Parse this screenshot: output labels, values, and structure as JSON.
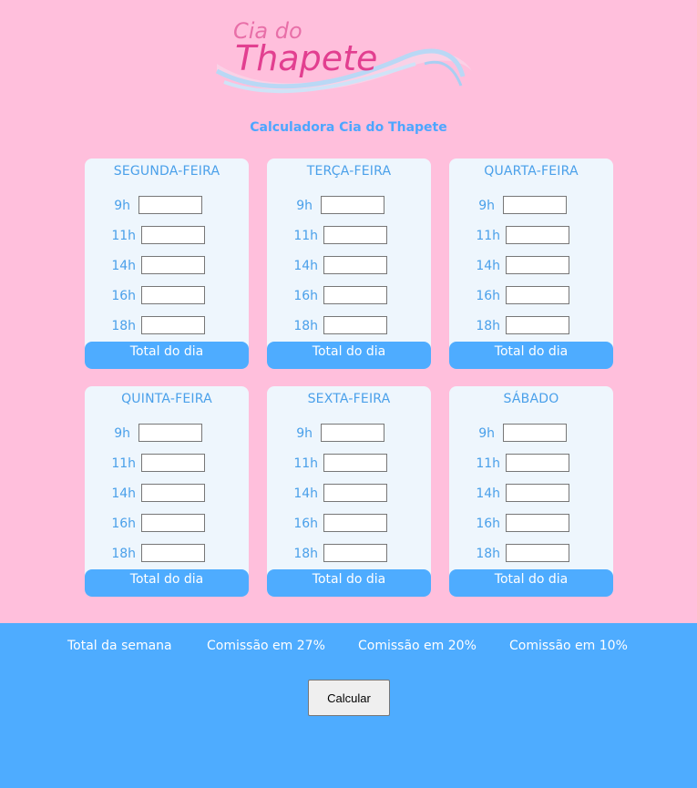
{
  "logo": {
    "line1": "Cia do",
    "line2": "Thapete"
  },
  "title": "Calculadora Cia do Thapete",
  "hours": [
    "9h",
    "11h",
    "14h",
    "16h",
    "18h"
  ],
  "days": [
    {
      "name": "SEGUNDA-FEIRA",
      "total_label": "Total do dia",
      "values": [
        "",
        "",
        "",
        "",
        ""
      ]
    },
    {
      "name": "TERÇA-FEIRA",
      "total_label": "Total do dia",
      "values": [
        "",
        "",
        "",
        "",
        ""
      ]
    },
    {
      "name": "QUARTA-FEIRA",
      "total_label": "Total do dia",
      "values": [
        "",
        "",
        "",
        "",
        ""
      ]
    },
    {
      "name": "QUINTA-FEIRA",
      "total_label": "Total do dia",
      "values": [
        "",
        "",
        "",
        "",
        ""
      ]
    },
    {
      "name": "SEXTA-FEIRA",
      "total_label": "Total do dia",
      "values": [
        "",
        "",
        "",
        "",
        ""
      ]
    },
    {
      "name": "SÁBADO",
      "total_label": "Total do dia",
      "values": [
        "",
        "",
        "",
        "",
        ""
      ]
    }
  ],
  "summary": {
    "total_week": "Total da semana",
    "commission_27": "Comissão em 27%",
    "commission_20": "Comissão em 20%",
    "commission_10": "Comissão em 10%"
  },
  "calculate_button": "Calcular",
  "colors": {
    "background": "#ffbfdc",
    "accent": "#4eacff",
    "card": "#eef6fd",
    "logo": "#e23f90"
  }
}
